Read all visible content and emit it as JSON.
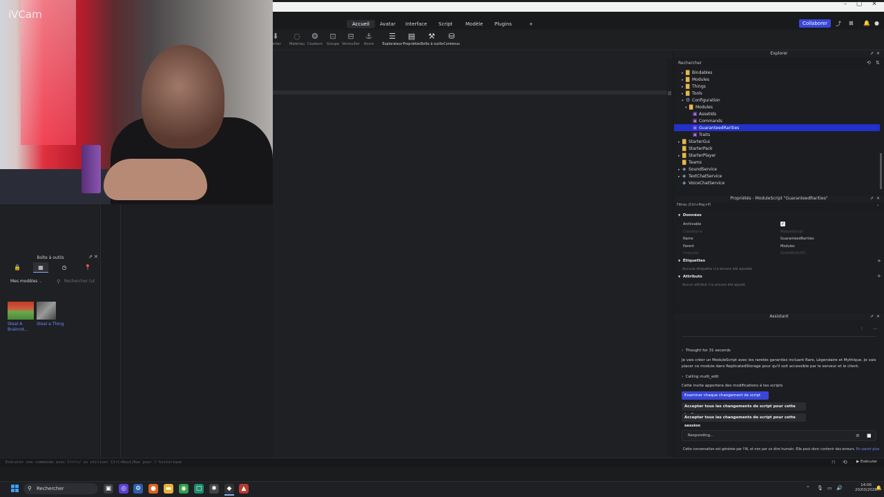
{
  "webcam": {
    "logo": "iVCam"
  },
  "window": {
    "controls": [
      "–",
      "▢",
      "✕"
    ]
  },
  "menu": {
    "tabs": [
      {
        "label": "Accueil",
        "active": true
      },
      {
        "label": "Avatar",
        "active": false
      },
      {
        "label": "Interface",
        "active": false
      },
      {
        "label": "Script",
        "active": false
      },
      {
        "label": "Modèle",
        "active": false
      },
      {
        "label": "Plugins",
        "active": false
      }
    ],
    "add_tab": "+",
    "collaborate": "Collaborer"
  },
  "ribbon": {
    "items": [
      {
        "label": "porter",
        "icon": "import-icon"
      },
      {
        "label": "Matériau",
        "icon": "material-icon"
      },
      {
        "label": "Couleurs",
        "icon": "color-icon"
      },
      {
        "label": "Groupe",
        "icon": "group-icon"
      },
      {
        "label": "Verrouiller",
        "icon": "lock-icon"
      },
      {
        "label": "Ancre",
        "icon": "anchor-icon"
      },
      {
        "label": "Explorateur",
        "icon": "explorer-icon"
      },
      {
        "label": "Propriétés",
        "icon": "properties-icon"
      },
      {
        "label": "Boîte à outils",
        "icon": "toolbox-icon"
      },
      {
        "label": "Contenus",
        "icon": "content-icon"
      }
    ]
  },
  "toolbox": {
    "title": "Boîte à outils",
    "select": "Mes modèles",
    "search_placeholder": "Rechercher (ut",
    "models": [
      {
        "name": "Steal A Brainrot..."
      },
      {
        "name": "Steal a Thing"
      }
    ]
  },
  "explorer": {
    "title": "Explorer",
    "search": "Rechercher",
    "items": [
      {
        "label": "Bindables",
        "indent": 1,
        "arrow": "▸",
        "kind": "folder",
        "selected": false
      },
      {
        "label": "Modules",
        "indent": 1,
        "arrow": "▸",
        "kind": "folder",
        "selected": false
      },
      {
        "label": "Things",
        "indent": 1,
        "arrow": "▸",
        "kind": "folder",
        "selected": false
      },
      {
        "label": "Tools",
        "indent": 1,
        "arrow": "▸",
        "kind": "folder",
        "selected": false
      },
      {
        "label": "Configuration",
        "indent": 1,
        "arrow": "▾",
        "kind": "gear",
        "selected": false
      },
      {
        "label": "Modules",
        "indent": 2,
        "arrow": "▾",
        "kind": "folder",
        "selected": false
      },
      {
        "label": "AssetIds",
        "indent": 3,
        "arrow": "",
        "kind": "module",
        "selected": false
      },
      {
        "label": "Commands",
        "indent": 3,
        "arrow": "",
        "kind": "module",
        "selected": false
      },
      {
        "label": "GuaranteedRarities",
        "indent": 3,
        "arrow": "",
        "kind": "module",
        "selected": true
      },
      {
        "label": "Traits",
        "indent": 3,
        "arrow": "",
        "kind": "module",
        "selected": false
      },
      {
        "label": "StarterGui",
        "indent": 0,
        "arrow": "▸",
        "kind": "folder",
        "selected": false
      },
      {
        "label": "StarterPack",
        "indent": 0,
        "arrow": "",
        "kind": "folder",
        "selected": false
      },
      {
        "label": "StarterPlayer",
        "indent": 0,
        "arrow": "▸",
        "kind": "folder",
        "selected": false
      },
      {
        "label": "Teams",
        "indent": 0,
        "arrow": "",
        "kind": "folder",
        "selected": false
      },
      {
        "label": "SoundService",
        "indent": 0,
        "arrow": "▸",
        "kind": "service",
        "selected": false
      },
      {
        "label": "TextChatService",
        "indent": 0,
        "arrow": "▸",
        "kind": "service",
        "selected": false
      },
      {
        "label": "VoiceChatService",
        "indent": 0,
        "arrow": "",
        "kind": "service",
        "selected": false
      }
    ]
  },
  "properties": {
    "title": "Propriétés - ModuleScript \"GuaranteedRarities\"",
    "filter": "Filtres (Ctrl+Maj+P)",
    "section_data": "Données",
    "rows": [
      {
        "key": "Archivable",
        "value": "",
        "dim": false
      },
      {
        "key": "ClassName",
        "value": "ModuleScript",
        "dim": true
      },
      {
        "key": "Name",
        "value": "GuaranteedRarities",
        "dim": false
      },
      {
        "key": "Parent",
        "value": "Modules",
        "dim": false
      },
      {
        "key": "UniqueId",
        "value": "02a9d6b3c5f2... ",
        "dim": true
      }
    ],
    "section_tags": "Étiquettes",
    "tags_note": "Aucune étiquette n'a encore été ajoutée",
    "section_attrs": "Attributs",
    "attrs_note": "Aucun attribut n'a encore été ajouté"
  },
  "assistant": {
    "title": "Assistant",
    "thought": "Thought for 31 seconds",
    "message": "Je vais créer un ModuleScript avec les raretés garanties incluant Rare, Légendaire et Mythique. Je vais placer ce module dans ReplicatedStorage pour qu'il soit accessible par le serveur et le client.",
    "calling": "Calling multi_edit",
    "note": "Cette invite apportera des modifications à tes scripts",
    "btn_review": "Examiner chaque changement de script",
    "btn_accept_prompt": "Accepter tous les changements de script pour cette invite",
    "btn_accept_session": "Accepter tous les changements de script pour cette session",
    "status": "Responding...",
    "footnote": "Cette conversation est générée par l'IA, et non par un être humain. Elle peut donc contenir des erreurs.",
    "footnote_link": "En savoir plus"
  },
  "command_bar": {
    "placeholder": "Exécuter une commande avec Ctrl+/ ou utiliser Ctrl+Haut/Bas pour l'historique",
    "execute": "Exécuter"
  },
  "taskbar": {
    "search": "Rechercher",
    "time": "14:06",
    "date": "20/03/2026"
  }
}
